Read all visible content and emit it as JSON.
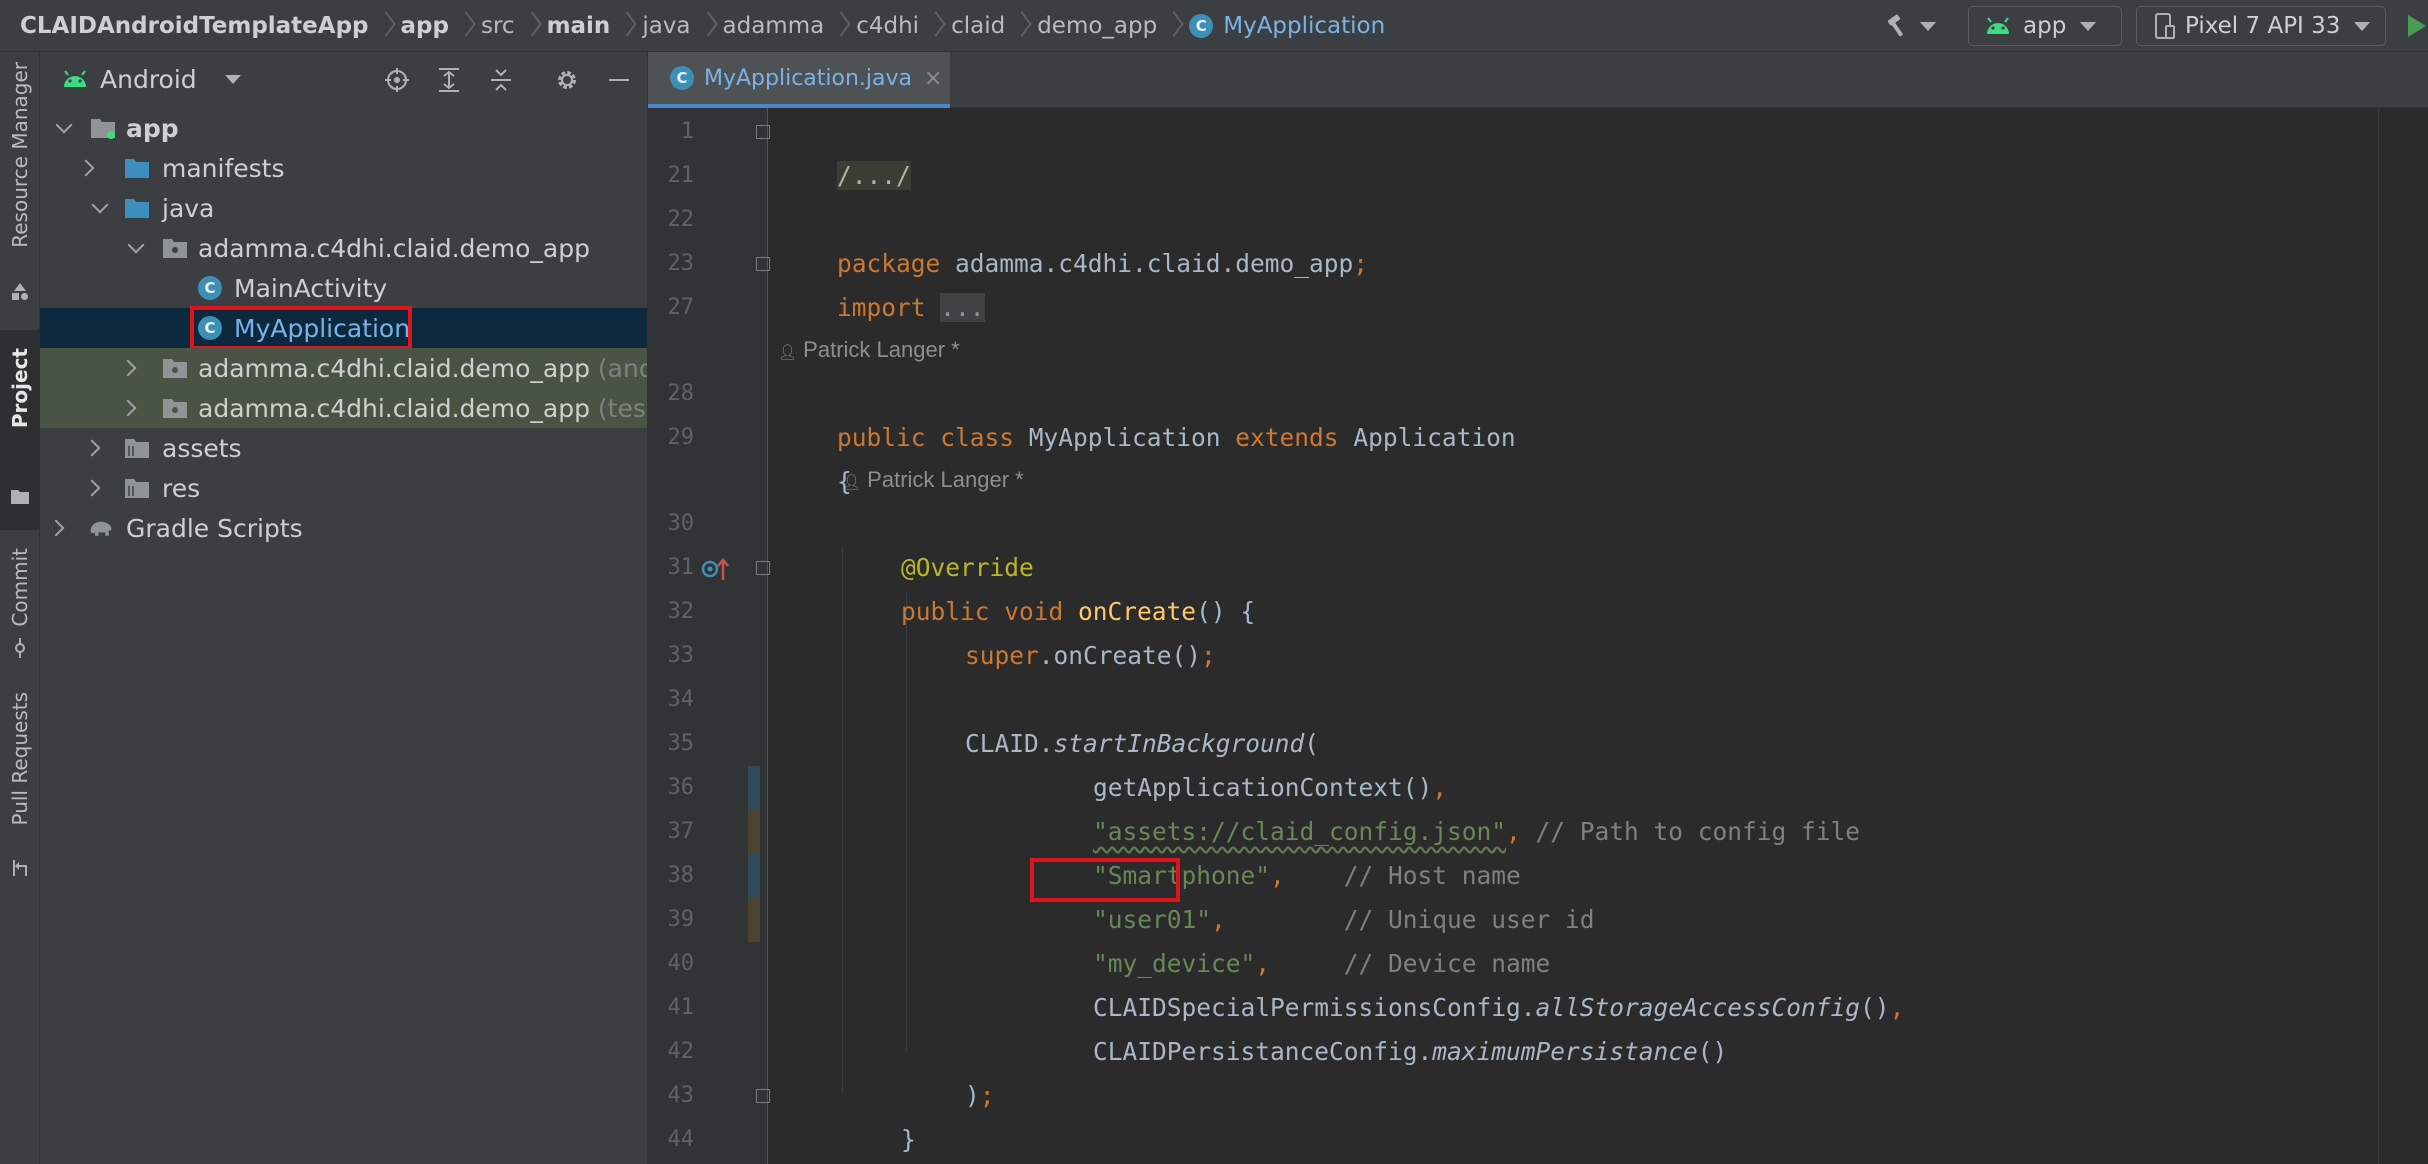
{
  "breadcrumbs": {
    "items": [
      "CLAIDAndroidTemplateApp",
      "app",
      "src",
      "main",
      "java",
      "adamma",
      "c4dhi",
      "claid",
      "demo_app"
    ],
    "file": "MyApplication"
  },
  "toolbar": {
    "run_config": "app",
    "device": "Pixel 7 API 33"
  },
  "tool_windows": {
    "resource_manager": "Resource Manager",
    "project": "Project",
    "commit": "Commit",
    "pull_requests": "Pull Requests"
  },
  "project_panel": {
    "view_mode": "Android",
    "tree": [
      {
        "label": "app",
        "hint": ""
      },
      {
        "label": "manifests",
        "hint": ""
      },
      {
        "label": "java",
        "hint": ""
      },
      {
        "label": "adamma.c4dhi.claid.demo_app",
        "hint": ""
      },
      {
        "label": "MainActivity",
        "hint": ""
      },
      {
        "label": "MyApplication",
        "hint": ""
      },
      {
        "label": "adamma.c4dhi.claid.demo_app",
        "hint": "(andr"
      },
      {
        "label": "adamma.c4dhi.claid.demo_app",
        "hint": "(test)"
      },
      {
        "label": "assets",
        "hint": ""
      },
      {
        "label": "res",
        "hint": ""
      },
      {
        "label": "Gradle Scripts",
        "hint": ""
      }
    ]
  },
  "editor": {
    "tab_label": "MyApplication.java",
    "tab_close": "×",
    "author_1": "Patrick Langer *",
    "author_2": "Patrick Langer *",
    "line_numbers": [
      "1",
      "21",
      "22",
      "23",
      "27",
      "28",
      "29",
      "30",
      "31",
      "32",
      "33",
      "34",
      "35",
      "36",
      "37",
      "38",
      "39",
      "40",
      "41",
      "42",
      "43",
      "44"
    ],
    "code": {
      "l1_fold": "/.../",
      "l22_kw": "package",
      "l22_rest": " adamma.c4dhi.claid.demo_app",
      "l22_semi": ";",
      "l23_kw": "import",
      "l23_fold": "...",
      "l28_kw1": "public class",
      "l28_name": " MyApplication ",
      "l28_kw2": "extends",
      "l28_rest": " Application",
      "l29": "{",
      "l30": "@Override",
      "l31_kw": "public void",
      "l31_fn": "onCreate",
      "l31_rest": "() {",
      "l32_kw": "super",
      "l32_rest": ".onCreate()",
      "l32_semi": ";",
      "l34_cls": "CLAID.",
      "l34_fn": "startInBackground",
      "l34_rest": "(",
      "l35": "getApplicationContext()",
      "l35_comma": ",",
      "l36_str": "\"assets://claid_config.json\"",
      "l36_comma": ",",
      "l36_cm": " // Path to config file",
      "l37_str": "\"Smartphone\"",
      "l37_comma": ",",
      "l37_cm": "    // Host name",
      "l38_str": "\"user01\"",
      "l38_comma": ",",
      "l38_cm": "        // Unique user id",
      "l39_str": "\"my_device\"",
      "l39_comma": ",",
      "l39_cm": "     // Device name",
      "l40_cls": "CLAIDSpecialPermissionsConfig.",
      "l40_fn": "allStorageAccessConfig",
      "l40_rest": "()",
      "l40_comma": ",",
      "l41_cls": "CLAIDPersistanceConfig.",
      "l41_fn": "maximumPersistance",
      "l41_rest": "()",
      "l42": ")",
      "l42_semi": ";",
      "l43": "}",
      "l44": "}"
    }
  },
  "colors": {
    "background": "#2b2b2b",
    "panel": "#3c3f41",
    "selection": "#0d293e",
    "highlight_box": "#e0141c",
    "keyword": "#cc7832",
    "string": "#6a8759",
    "comment": "#808080",
    "annotation": "#bbb529",
    "method": "#ffc66d"
  }
}
